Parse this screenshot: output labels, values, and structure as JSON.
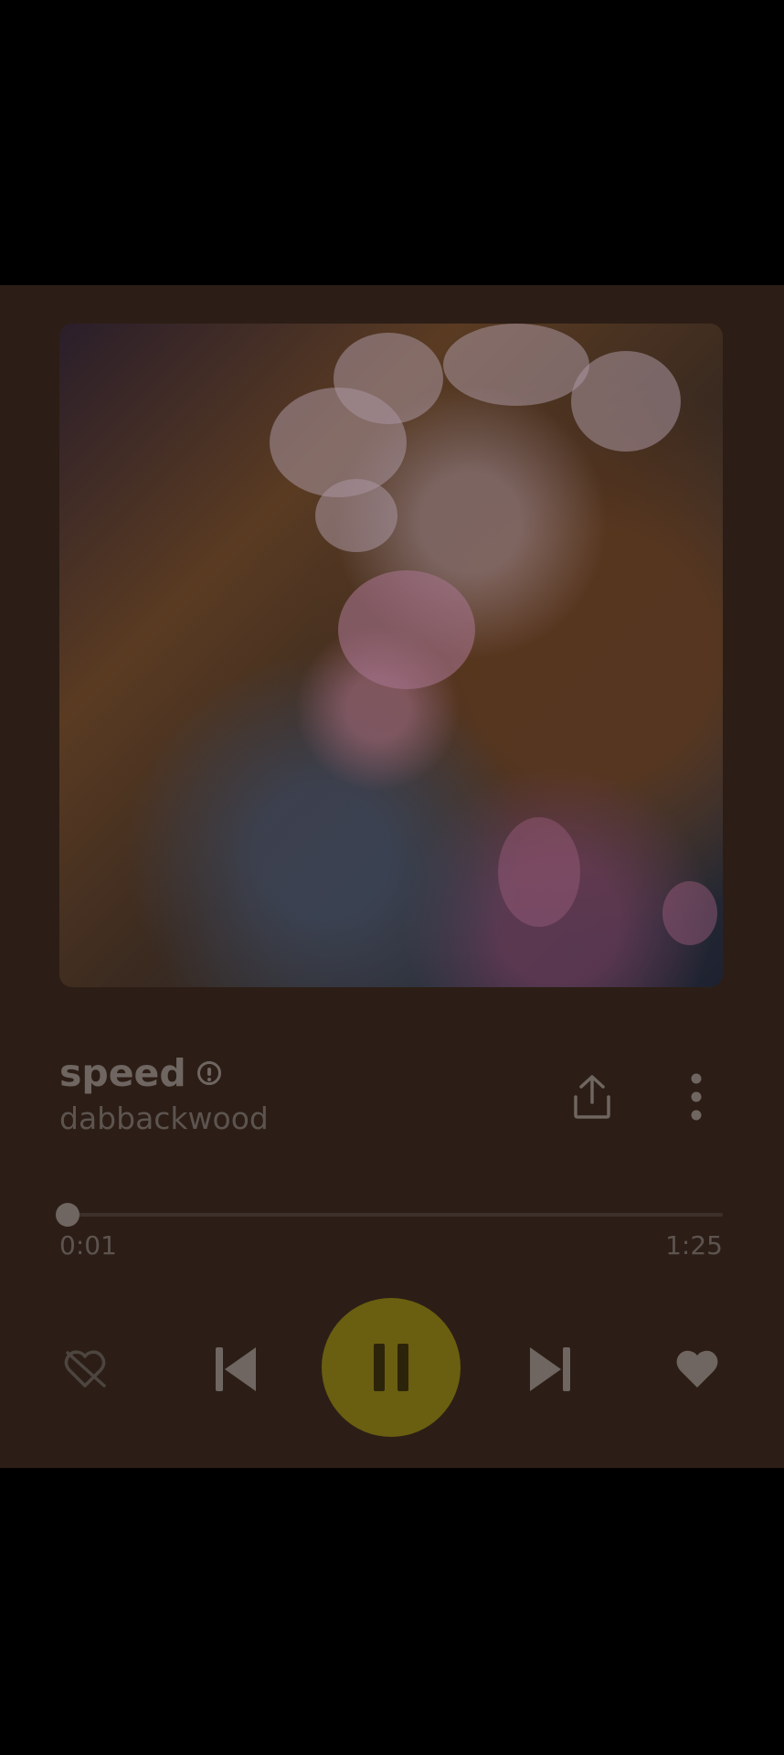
{
  "track": {
    "title": "speed",
    "artist": "dabbackwood",
    "explicit_icon": "explicit-info-icon"
  },
  "actions": {
    "share_icon": "share-icon",
    "more_icon": "more-vertical-icon"
  },
  "progress": {
    "elapsed": "0:01",
    "duration": "1:25",
    "fraction": 0.012
  },
  "controls": {
    "dislike_icon": "dislike-heart-icon",
    "previous_icon": "skip-previous-icon",
    "pause_icon": "pause-icon",
    "next_icon": "skip-next-icon",
    "like_icon": "heart-icon"
  },
  "colors": {
    "accent": "#6a5f10",
    "background": "#2c1e16",
    "text": "#6f6661"
  }
}
